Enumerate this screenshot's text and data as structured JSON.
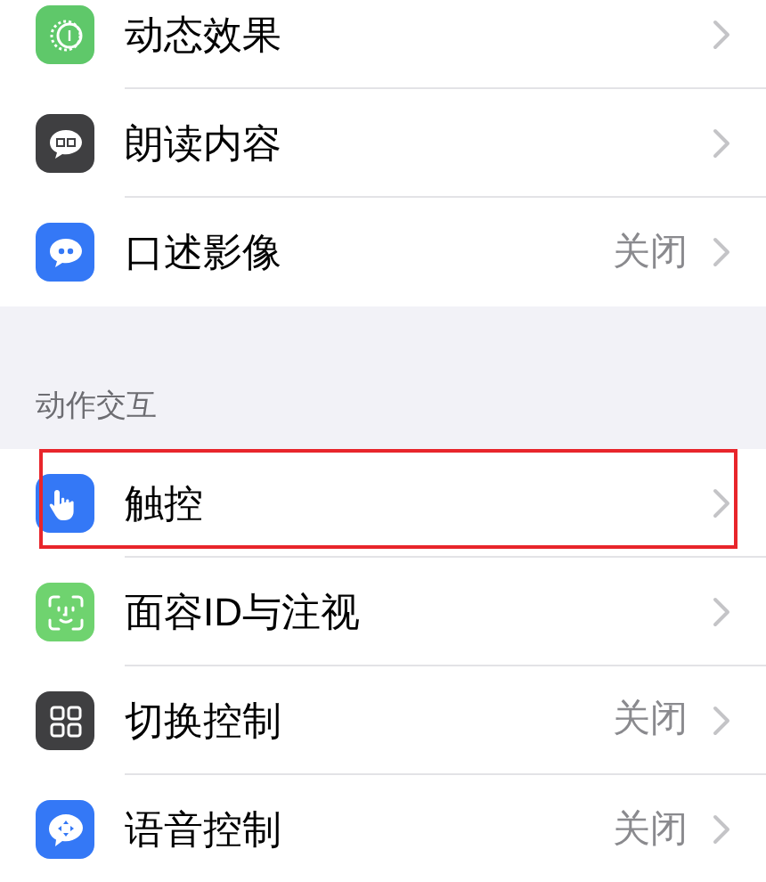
{
  "groups": [
    {
      "items": [
        {
          "kind": "motion",
          "label": "动态效果",
          "highlighted": false
        },
        {
          "kind": "speech",
          "label": "朗读内容",
          "highlighted": false
        },
        {
          "kind": "audio-description",
          "label": "口述影像",
          "value": "关闭",
          "highlighted": false
        }
      ]
    },
    {
      "header": "动作交互",
      "items": [
        {
          "kind": "touch",
          "label": "触控",
          "highlighted": true
        },
        {
          "kind": "face",
          "label": "面容ID与注视",
          "highlighted": false
        },
        {
          "kind": "switch",
          "label": "切换控制",
          "value": "关闭",
          "highlighted": false
        },
        {
          "kind": "voice",
          "label": "语音控制",
          "value": "关闭",
          "highlighted": false
        }
      ]
    }
  ]
}
